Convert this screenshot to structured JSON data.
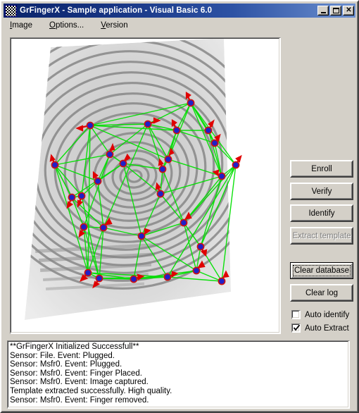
{
  "window": {
    "title": "GrFingerX - Sample application - Visual Basic 6.0",
    "icon": "checkerboard-icon",
    "titlebar_color": "#0a246a",
    "face_color": "#d4d0c8",
    "controls": {
      "minimize": "minimize-button",
      "maximize": "maximize-button",
      "close": "close-button"
    }
  },
  "menubar": {
    "items": [
      {
        "label": "Image",
        "accel": "I"
      },
      {
        "label": "Options...",
        "accel": "O"
      },
      {
        "label": "Version",
        "accel": "V"
      }
    ]
  },
  "image_panel": {
    "name": "fingerprint-preview",
    "background": "#ffffff",
    "overlay": {
      "minutiae_dot_color": "#2020c8",
      "minutiae_dot_edge": "#d01010",
      "direction_arrow_color": "#e00000",
      "link_line_color": "#00e000"
    }
  },
  "buttons": [
    {
      "key": "enroll",
      "label": "Enroll",
      "enabled": true,
      "focused": false
    },
    {
      "key": "verify",
      "label": "Verify",
      "enabled": true,
      "focused": false
    },
    {
      "key": "identify",
      "label": "Identify",
      "enabled": true,
      "focused": false
    },
    {
      "key": "extract_template",
      "label": "Extract template",
      "enabled": false,
      "focused": false
    },
    {
      "key": "clear_database",
      "label": "Clear database",
      "enabled": true,
      "focused": true
    },
    {
      "key": "clear_log",
      "label": "Clear log",
      "enabled": true,
      "focused": false
    }
  ],
  "checkboxes": [
    {
      "key": "auto_identify",
      "label": "Auto identify",
      "checked": false
    },
    {
      "key": "auto_extract",
      "label": "Auto Extract",
      "checked": true
    }
  ],
  "log": {
    "lines": [
      "**GrFingerX Initialized Successfull**",
      "Sensor: File. Event: Plugged.",
      "Sensor: Msfr0. Event: Plugged.",
      "Sensor: Msfr0. Event: Finger Placed.",
      "Sensor: Msfr0. Event: Image captured.",
      "Template extracted successfully. High quality.",
      "Sensor: Msfr0. Event: Finger removed."
    ]
  }
}
